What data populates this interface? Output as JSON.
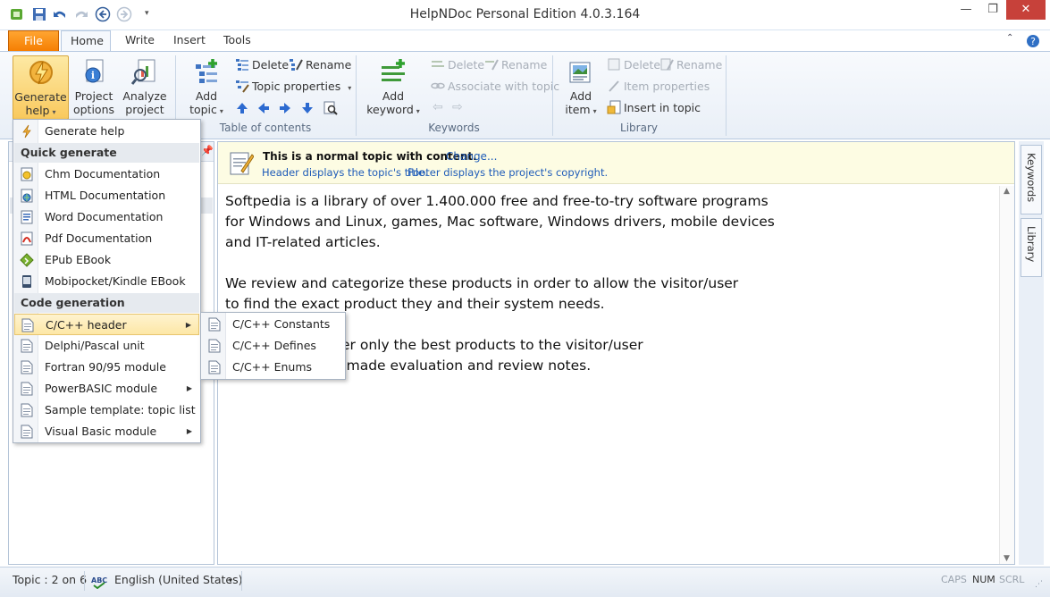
{
  "app": {
    "title": "HelpNDoc Personal Edition 4.0.3.164"
  },
  "tabs": [
    {
      "label": "File"
    },
    {
      "label": "Home"
    },
    {
      "label": "Write"
    },
    {
      "label": "Insert"
    },
    {
      "label": "Tools"
    }
  ],
  "ribbon": {
    "generate": {
      "line1": "Generate",
      "line2": "help"
    },
    "project_options": {
      "line1": "Project",
      "line2": "options"
    },
    "analyze": {
      "line1": "Analyze",
      "line2": "project"
    },
    "add_topic": {
      "line1": "Add",
      "line2": "topic"
    },
    "toc": {
      "delete": "Delete",
      "rename": "Rename",
      "topic_properties": "Topic properties",
      "label": "Table of contents"
    },
    "keywords": {
      "add_line1": "Add",
      "add_line2": "keyword",
      "delete": "Delete",
      "rename": "Rename",
      "associate": "Associate with topic",
      "label": "Keywords"
    },
    "library": {
      "add_line1": "Add",
      "add_line2": "item",
      "delete": "Delete",
      "rename": "Rename",
      "item_properties": "Item properties",
      "insert_in_topic": "Insert in topic",
      "label": "Library"
    }
  },
  "menu": {
    "generate_help": "Generate help",
    "quick_generate_header": "Quick generate",
    "quick_items": [
      {
        "label": "Chm Documentation",
        "icon": "chm-icon"
      },
      {
        "label": "HTML Documentation",
        "icon": "html-icon"
      },
      {
        "label": "Word Documentation",
        "icon": "word-icon"
      },
      {
        "label": "Pdf Documentation",
        "icon": "pdf-icon"
      },
      {
        "label": "EPub EBook",
        "icon": "epub-icon"
      },
      {
        "label": "Mobipocket/Kindle EBook",
        "icon": "kindle-icon"
      }
    ],
    "code_generation_header": "Code generation",
    "code_items": [
      {
        "label": "C/C++ header",
        "has_submenu": true
      },
      {
        "label": "Delphi/Pascal unit",
        "has_submenu": false
      },
      {
        "label": "Fortran 90/95 module",
        "has_submenu": false
      },
      {
        "label": "PowerBASIC module",
        "has_submenu": true
      },
      {
        "label": "Sample template: topic list",
        "has_submenu": false
      },
      {
        "label": "Visual Basic module",
        "has_submenu": true
      }
    ],
    "submenu": [
      {
        "label": "C/C++ Constants"
      },
      {
        "label": "C/C++ Defines"
      },
      {
        "label": "C/C++ Enums"
      }
    ]
  },
  "infobar": {
    "message": "This is a normal topic with content.",
    "change_link": "Change...",
    "header_note": "Header displays the topic's title.",
    "footer_note": "Footer displays the project's copyright."
  },
  "editor": {
    "paragraphs": [
      "Softpedia is a library of over 1.400.000 free and free-to-try software programs\nfor Windows and Linux, games, Mac software, Windows drivers, mobile devices\nand IT-related articles.",
      "We review and categorize these products in order to allow the visitor/user\nto find the exact product they and their system needs.",
      "er only the best products to the visitor/user\n-made evaluation and review notes."
    ]
  },
  "side_tabs": [
    {
      "label": "Keywords"
    },
    {
      "label": "Library"
    }
  ],
  "status": {
    "topic": "Topic : 2 on 6",
    "language": "English (United States)",
    "caps": "CAPS",
    "num": "NUM",
    "scrl": "SCRL"
  },
  "colors": {
    "accent_file_tab": "#f57d00",
    "ribbon_bg": "#e9eff7",
    "infobar_bg": "#fdfce3",
    "link": "#1e5bb8",
    "highlight": "#fde7a6"
  }
}
